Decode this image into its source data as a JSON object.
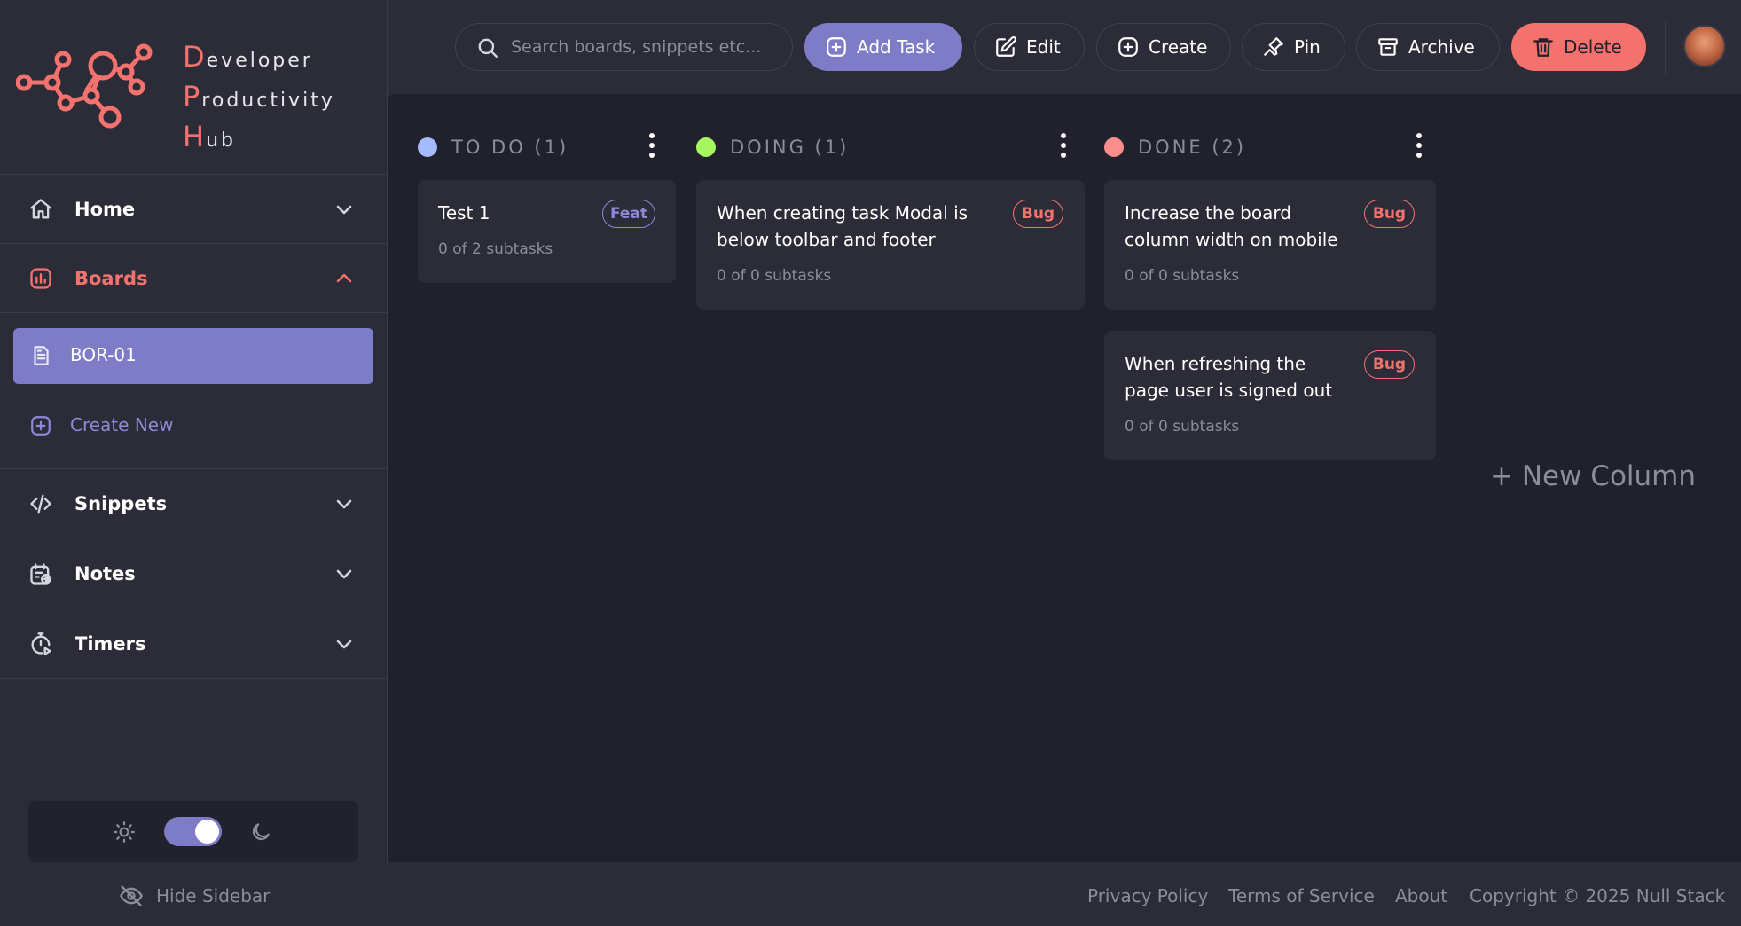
{
  "app": {
    "logo_lines": [
      {
        "initial": "D",
        "rest": "eveloper"
      },
      {
        "initial": "P",
        "rest": "roductivity"
      },
      {
        "initial": "H",
        "rest": "ub"
      }
    ]
  },
  "sidebar": {
    "nav": [
      {
        "label": "Home",
        "icon": "home-icon"
      },
      {
        "label": "Boards",
        "icon": "chart-bars-icon",
        "expanded": true
      },
      {
        "label": "Snippets",
        "icon": "code-icon"
      },
      {
        "label": "Notes",
        "icon": "notes-icon"
      },
      {
        "label": "Timers",
        "icon": "timer-icon"
      }
    ],
    "boards": [
      {
        "label": "BOR-01",
        "icon": "document-icon"
      }
    ],
    "create_new": "Create New",
    "hide_sidebar": "Hide Sidebar",
    "theme": {
      "mode": "dark"
    }
  },
  "header": {
    "search_placeholder": "Search boards, snippets etc...",
    "buttons": {
      "add_task": "Add Task",
      "edit": "Edit",
      "create": "Create",
      "pin": "Pin",
      "archive": "Archive",
      "delete": "Delete"
    }
  },
  "board": {
    "columns": [
      {
        "title": "TO DO (1)",
        "color": "#a5bbff",
        "tasks": [
          {
            "title": "Test 1",
            "subtasks": "0 of 2 subtasks",
            "tag": "Feat"
          }
        ]
      },
      {
        "title": "DOING (1)",
        "color": "#a6f75d",
        "tasks": [
          {
            "title": "When creating task Modal is below toolbar and footer",
            "subtasks": "0 of 0 subtasks",
            "tag": "Bug"
          }
        ]
      },
      {
        "title": "DONE (2)",
        "color": "#fb8d8d",
        "tasks": [
          {
            "title": "Increase the board column width on mobile",
            "subtasks": "0 of 0 subtasks",
            "tag": "Bug"
          },
          {
            "title": "When refreshing the page user is signed out",
            "subtasks": "0 of 0 subtasks",
            "tag": "Bug"
          }
        ]
      }
    ],
    "new_column": "+ New Column"
  },
  "footer": {
    "links": [
      "Privacy Policy",
      "Terms of Service",
      "About"
    ],
    "copyright": "Copyright © 2025 Null Stack"
  },
  "colors": {
    "accent": "#7f7cc7",
    "danger": "#f4726e",
    "background": "#2b2c37",
    "board_background": "#20212c"
  }
}
